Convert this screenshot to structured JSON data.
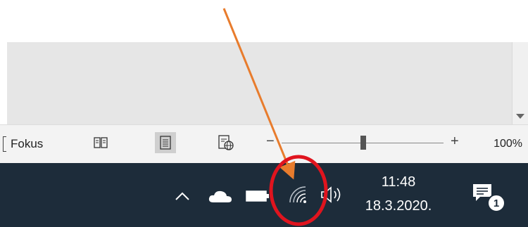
{
  "status_bar": {
    "focus_label": "Fokus",
    "zoom_minus": "−",
    "zoom_plus": "+",
    "zoom_percent": 100,
    "zoom_level": "100%",
    "views": [
      {
        "name": "read-mode",
        "icon": "book-icon",
        "active": false
      },
      {
        "name": "print-layout",
        "icon": "page-icon",
        "active": true
      },
      {
        "name": "web-layout",
        "icon": "web-page-icon",
        "active": false
      }
    ]
  },
  "taskbar": {
    "time": "11:48",
    "date": "18.3.2020.",
    "tray_icons": [
      "chevron-up-icon",
      "onedrive-cloud-icon",
      "battery-icon",
      "wifi-icon",
      "speaker-icon"
    ],
    "notification_count": "1"
  },
  "annotation": {
    "arrow_color": "#e87c2d",
    "circle_color": "#e0141e"
  },
  "colors": {
    "taskbar_bg": "#1d2c3a",
    "status_bar_bg": "#f3f3f3"
  }
}
